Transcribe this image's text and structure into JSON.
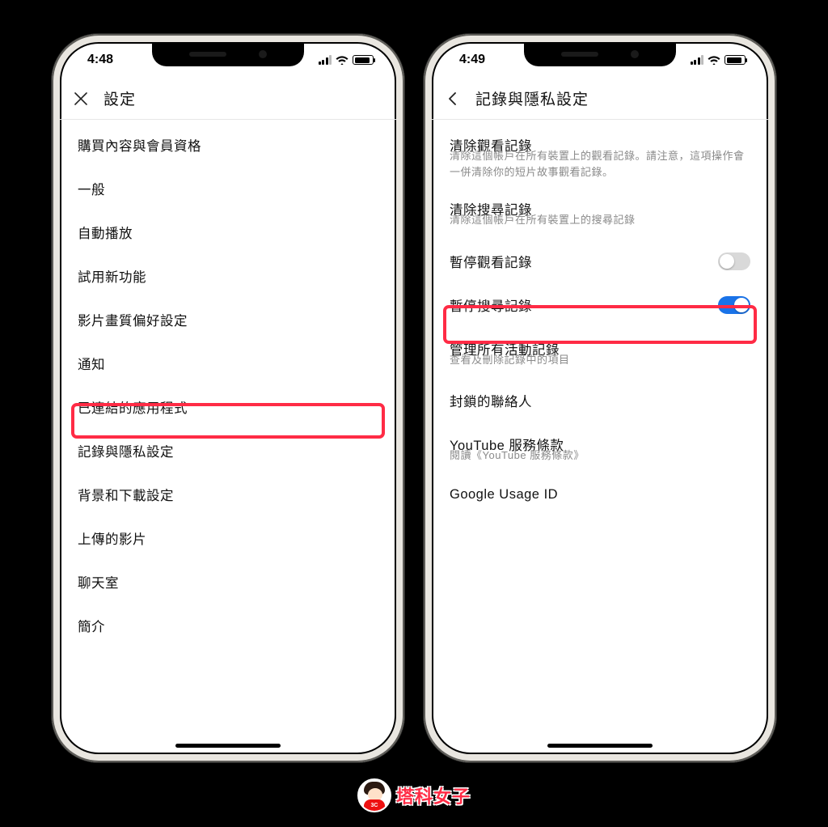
{
  "watermark": {
    "text": "塔科女子",
    "badge": "3C"
  },
  "phones": [
    {
      "statusTime": "4:48",
      "nav": {
        "icon": "close",
        "title": "設定"
      },
      "items": [
        {
          "label": "購買內容與會員資格"
        },
        {
          "label": "一般"
        },
        {
          "label": "自動播放"
        },
        {
          "label": "試用新功能"
        },
        {
          "label": "影片畫質偏好設定"
        },
        {
          "label": "通知"
        },
        {
          "label": "已連結的應用程式"
        },
        {
          "label": "記錄與隱私設定",
          "highlight": true
        },
        {
          "label": "背景和下載設定"
        },
        {
          "label": "上傳的影片"
        },
        {
          "label": "聊天室"
        },
        {
          "label": "簡介"
        }
      ]
    },
    {
      "statusTime": "4:49",
      "nav": {
        "icon": "back",
        "title": "記錄與隱私設定"
      },
      "items2": [
        {
          "label": "清除觀看記錄",
          "sub": "清除這個帳戶在所有裝置上的觀看記錄。請注意，這項操作會一併清除你的短片故事觀看記錄。"
        },
        {
          "label": "清除搜尋記錄",
          "sub": "清除這個帳戶在所有裝置上的搜尋記錄"
        },
        {
          "label": "暫停觀看記錄",
          "toggle": "off"
        },
        {
          "label": "暫停搜尋記錄",
          "toggle": "on",
          "highlight": true
        },
        {
          "label": "管理所有活動記錄",
          "sub": "查看及刪除記錄中的項目"
        },
        {
          "label": "封鎖的聯絡人"
        },
        {
          "label": "YouTube 服務條款",
          "sub": "閱讀《YouTube 服務條款》"
        },
        {
          "label": "Google Usage ID"
        }
      ]
    }
  ]
}
